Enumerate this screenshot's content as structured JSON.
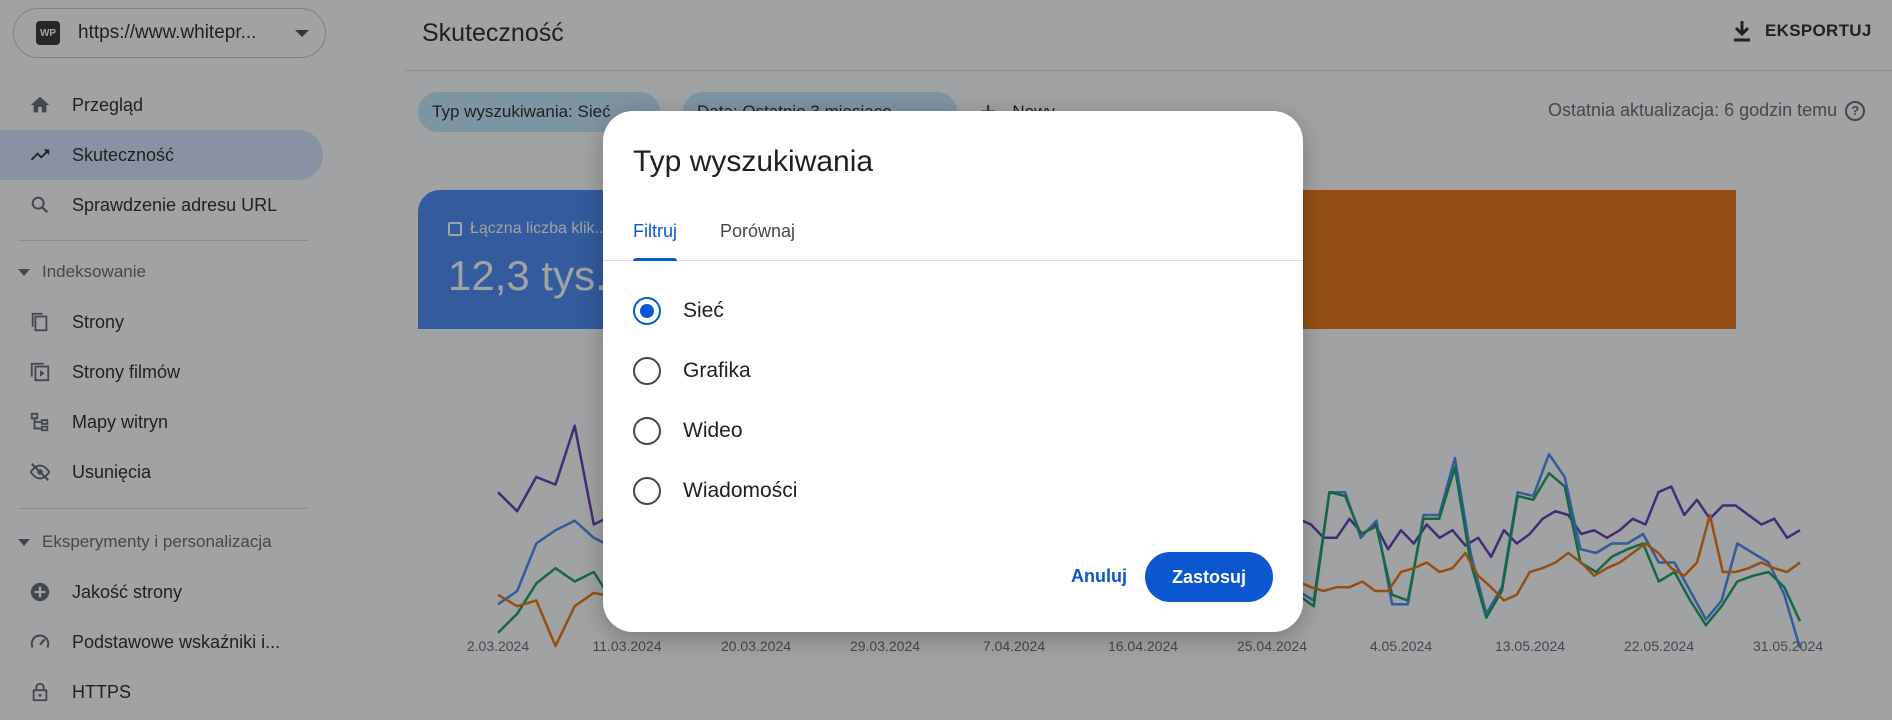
{
  "property": {
    "url": "https://www.whitepr...",
    "logo_text": "WP"
  },
  "sidebar": {
    "items": [
      {
        "label": "Przegląd",
        "icon": "home-icon"
      },
      {
        "label": "Skuteczność",
        "icon": "trending-up-icon",
        "active": true
      },
      {
        "label": "Sprawdzenie adresu URL",
        "icon": "search-icon"
      }
    ],
    "sections": [
      {
        "label": "Indeksowanie",
        "items": [
          {
            "label": "Strony",
            "icon": "pages-icon"
          },
          {
            "label": "Strony filmów",
            "icon": "video-pages-icon"
          },
          {
            "label": "Mapy witryn",
            "icon": "sitemap-icon"
          },
          {
            "label": "Usunięcia",
            "icon": "visibility-off-icon"
          }
        ]
      },
      {
        "label": "Eksperymenty i personalizacja",
        "items": [
          {
            "label": "Jakość strony",
            "icon": "page-quality-icon"
          },
          {
            "label": "Podstawowe wskaźniki i...",
            "icon": "speed-icon"
          },
          {
            "label": "HTTPS",
            "icon": "lock-icon"
          }
        ]
      }
    ]
  },
  "header": {
    "title": "Skuteczność",
    "export_label": "EKSPORTUJ"
  },
  "filters": {
    "chips": [
      "Typ wyszukiwania: Sieć",
      "Data: Ostatnie 3 miesiące"
    ],
    "add_new_label": "Nowy",
    "last_update": "Ostatnia aktualizacja: 6 godzin temu"
  },
  "metrics": {
    "clicks_label": "Łączna liczba klik...",
    "clicks_value": "12,3 tys."
  },
  "chart_data": {
    "type": "line",
    "x_tick_labels": [
      "2.03.2024",
      "11.03.2024",
      "20.03.2024",
      "29.03.2024",
      "7.04.2024",
      "16.04.2024",
      "25.04.2024",
      "4.05.2024",
      "13.05.2024",
      "22.05.2024",
      "31.05.2024"
    ],
    "series": [
      {
        "color": "#5e35b1",
        "segment": "left",
        "values": [
          0.62,
          0.52,
          0.7,
          0.66,
          0.97,
          0.45,
          0.5
        ]
      },
      {
        "color": "#4285f4",
        "segment": "left",
        "values": [
          0.03,
          0.1,
          0.35,
          0.42,
          0.47,
          0.38,
          0.33
        ]
      },
      {
        "color": "#0f9d58",
        "segment": "left",
        "values": [
          -0.12,
          -0.02,
          0.14,
          0.22,
          0.15,
          0.2,
          0.04
        ]
      },
      {
        "color": "#e8710a",
        "segment": "left",
        "values": [
          0.08,
          0.02,
          0.05,
          -0.19,
          0.02,
          0.09,
          0.07
        ]
      },
      {
        "color": "#5e35b1",
        "segment": "right",
        "values": [
          0.48,
          0.45,
          0.38,
          0.38,
          0.48,
          0.4,
          0.45,
          0.32,
          0.42,
          0.35,
          0.45,
          0.38,
          0.42,
          0.34,
          0.38,
          0.28,
          0.42,
          0.35,
          0.4,
          0.48,
          0.52,
          0.5,
          0.4,
          0.42,
          0.38,
          0.42,
          0.48,
          0.45,
          0.62,
          0.65,
          0.5,
          0.58,
          0.48,
          0.55,
          0.55,
          0.5,
          0.45,
          0.48,
          0.38,
          0.42
        ]
      },
      {
        "color": "#4285f4",
        "segment": "right",
        "values": [
          0.1,
          0.05,
          0.62,
          0.62,
          0.38,
          0.47,
          0.03,
          0.03,
          0.5,
          0.5,
          0.8,
          0.3,
          -0.02,
          0.12,
          0.62,
          0.6,
          0.82,
          0.7,
          0.32,
          0.3,
          0.35,
          0.35,
          0.4,
          0.25,
          0.25,
          0.1,
          -0.05,
          0.05,
          0.35,
          0.3,
          0.25,
          0.08,
          -0.2
        ]
      },
      {
        "color": "#0f9d58",
        "segment": "right",
        "values": [
          0.08,
          0.02,
          0.62,
          0.6,
          0.4,
          0.44,
          0.08,
          0.05,
          0.48,
          0.48,
          0.75,
          0.25,
          -0.04,
          0.1,
          0.6,
          0.58,
          0.72,
          0.65,
          0.25,
          0.2,
          0.28,
          0.32,
          0.35,
          0.15,
          0.2,
          0.05,
          -0.08,
          0.02,
          0.15,
          0.18,
          0.2,
          0.12,
          -0.06
        ]
      },
      {
        "color": "#e8710a",
        "segment": "right",
        "values": [
          0.15,
          0.12,
          0.1,
          0.12,
          0.12,
          0.15,
          0.1,
          0.1,
          0.2,
          0.22,
          0.25,
          0.2,
          0.22,
          0.3,
          0.18,
          0.12,
          0.05,
          0.08,
          0.2,
          0.22,
          0.25,
          0.3,
          0.25,
          0.18,
          0.22,
          0.25,
          0.3,
          0.35,
          0.3,
          0.22,
          0.18,
          0.25,
          0.5,
          0.2,
          0.2,
          0.22,
          0.25,
          0.22,
          0.2,
          0.25
        ]
      }
    ]
  },
  "dialog": {
    "title": "Typ wyszukiwania",
    "tabs": [
      {
        "label": "Filtruj",
        "active": true
      },
      {
        "label": "Porównaj",
        "active": false
      }
    ],
    "options": [
      {
        "label": "Sieć",
        "checked": true
      },
      {
        "label": "Grafika",
        "checked": false
      },
      {
        "label": "Wideo",
        "checked": false
      },
      {
        "label": "Wiadomości",
        "checked": false
      }
    ],
    "cancel_label": "Anuluj",
    "apply_label": "Zastosuj"
  },
  "colors": {
    "accent": "#0b57d0",
    "active_nav": "#d3e3fd",
    "chip": "#c2e7ff",
    "clicks_card": "#4285f4",
    "position_card": "#e8710a"
  }
}
